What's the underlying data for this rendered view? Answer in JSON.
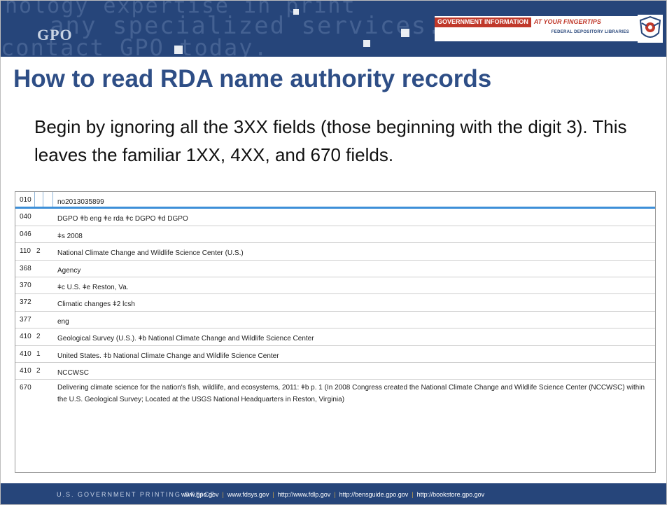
{
  "header": {
    "background_words": [
      "nology expertise in print",
      "any specialized services.",
      "contact GPO today."
    ],
    "logo_text": "GPO",
    "banner_red": "GOVERNMENT INFORMATION",
    "banner_italic": "AT YOUR FINGERTIPS",
    "banner_sub": "FEDERAL DEPOSITORY LIBRARIES",
    "seal_icon": "fdlp-eagle-seal-icon"
  },
  "slide": {
    "title": "How to read RDA name authority records",
    "body": "Begin by ignoring all the 3XX fields (those beginning with the digit 3). This leaves the familiar 1XX, 4XX, and 670 fields."
  },
  "record": {
    "rows": [
      {
        "tag": "010",
        "ind1": "",
        "ind2": "",
        "text": "no2013035899"
      },
      {
        "tag": "040",
        "ind1": "",
        "ind2": "",
        "text": "DGPO ǂb eng ǂe rda ǂc DGPO ǂd DGPO"
      },
      {
        "tag": "046",
        "ind1": "",
        "ind2": "",
        "text": "ǂs 2008"
      },
      {
        "tag": "110",
        "ind1": "2",
        "ind2": "",
        "text": "National Climate Change and Wildlife Science Center (U.S.)"
      },
      {
        "tag": "368",
        "ind1": "",
        "ind2": "",
        "text": "Agency"
      },
      {
        "tag": "370",
        "ind1": "",
        "ind2": "",
        "text": "ǂc U.S. ǂe Reston, Va."
      },
      {
        "tag": "372",
        "ind1": "",
        "ind2": "",
        "text": "Climatic changes ǂ2 lcsh"
      },
      {
        "tag": "377",
        "ind1": "",
        "ind2": "",
        "text": "eng"
      },
      {
        "tag": "410",
        "ind1": "2",
        "ind2": "",
        "text": "Geological Survey (U.S.). ǂb National Climate Change and Wildlife Science Center"
      },
      {
        "tag": "410",
        "ind1": "1",
        "ind2": "",
        "text": "United States. ǂb National Climate Change and Wildlife Science Center"
      },
      {
        "tag": "410",
        "ind1": "2",
        "ind2": "",
        "text": "NCCWSC"
      },
      {
        "tag": "670",
        "ind1": "",
        "ind2": "",
        "text": "Delivering climate science for the nation's fish, wildlife, and ecosystems, 2011: ǂb p. 1 (In 2008 Congress created the National Climate Change and Wildlife Science Center (NCCWSC) within the U.S. Geological Survey; Located at the USGS National Headquarters in Reston, Virginia)"
      }
    ]
  },
  "footer": {
    "org": "U.S. GOVERNMENT PRINTING OFFICE",
    "links": [
      "www.gpo.gov",
      "www.fdsys.gov",
      "http://www.fdlp.gov",
      "http://bensguide.gpo.gov",
      "http://bookstore.gpo.gov"
    ],
    "separator": "|"
  },
  "colors": {
    "header_bg": "#26457a",
    "title": "#2e4e86",
    "banner_red": "#c0392b",
    "selected_row_border": "#3d8fd8"
  }
}
